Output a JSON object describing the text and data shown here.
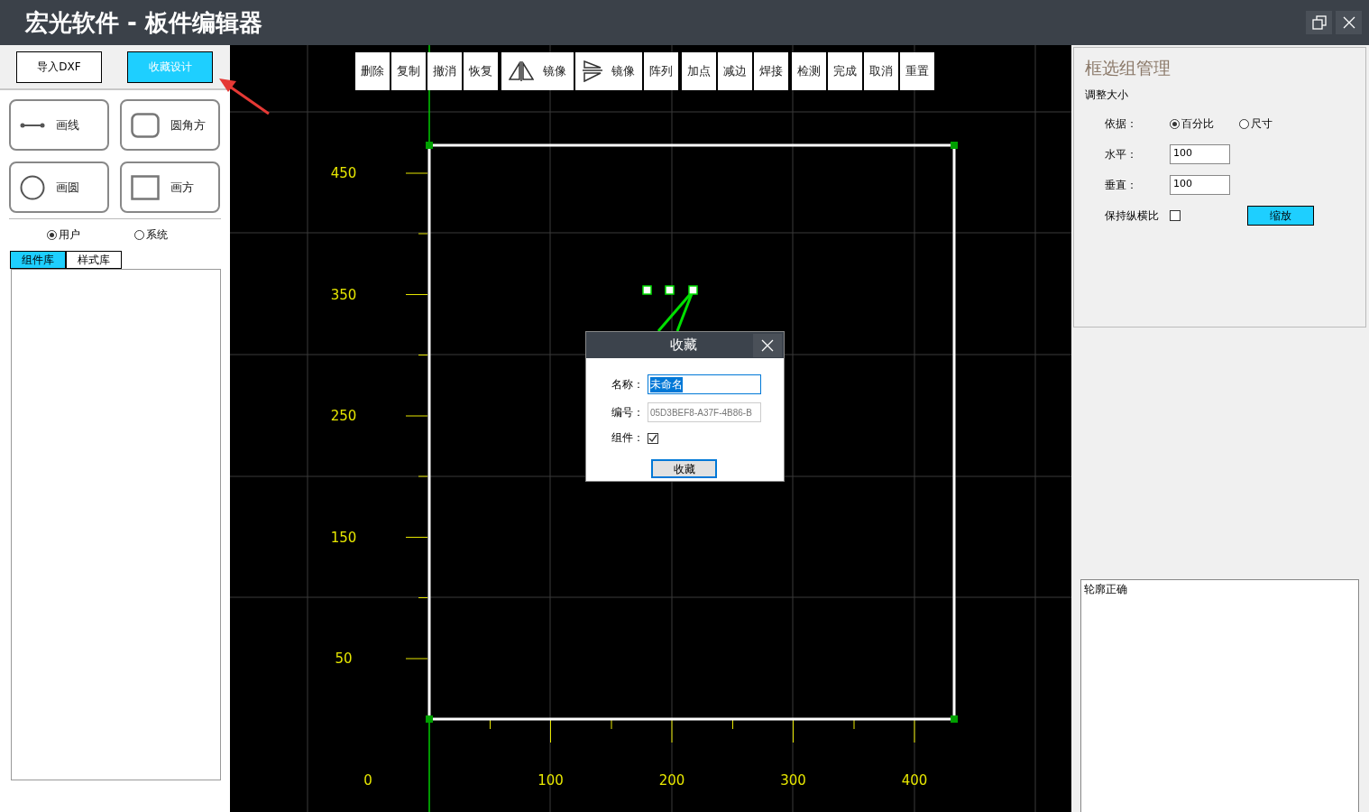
{
  "window": {
    "title": "宏光软件 - 板件编辑器"
  },
  "left_panel": {
    "top_buttons": [
      {
        "label": "导入DXF",
        "kind": "plain"
      },
      {
        "label": "收藏设计",
        "kind": "accent"
      }
    ],
    "tools": [
      {
        "label": "画线",
        "kind": "line"
      },
      {
        "label": "圆角方",
        "kind": "rounded-square"
      },
      {
        "label": "画圆",
        "kind": "circle"
      },
      {
        "label": "画方",
        "kind": "square"
      }
    ],
    "scope": [
      {
        "label": "用户",
        "selected": true
      },
      {
        "label": "系统",
        "selected": false
      }
    ],
    "tabs": [
      {
        "label": "组件库",
        "selected": true
      },
      {
        "label": "样式库",
        "selected": false
      }
    ]
  },
  "toolbar": {
    "groups": [
      {
        "buttons": [
          {
            "label": "删除",
            "kind": "text"
          },
          {
            "label": "复制",
            "kind": "text"
          },
          {
            "label": "撤消",
            "kind": "text"
          },
          {
            "label": "恢复",
            "kind": "text"
          }
        ]
      },
      {
        "buttons": [
          {
            "label": "镜像",
            "kind": "mirror-vertical"
          },
          {
            "label": "镜像",
            "kind": "mirror-horizontal"
          },
          {
            "label": "阵列",
            "kind": "text"
          }
        ]
      },
      {
        "buttons": [
          {
            "label": "加点",
            "kind": "text"
          },
          {
            "label": "减边",
            "kind": "text"
          },
          {
            "label": "焊接",
            "kind": "text"
          }
        ]
      },
      {
        "buttons": [
          {
            "label": "检测",
            "kind": "text"
          },
          {
            "label": "完成",
            "kind": "text"
          },
          {
            "label": "取消",
            "kind": "text"
          },
          {
            "label": "重置",
            "kind": "text"
          }
        ]
      }
    ]
  },
  "canvas": {
    "y_labels": [
      "450",
      "350",
      "250",
      "150",
      "50"
    ],
    "x_labels": [
      "0",
      "100",
      "200",
      "300",
      "400"
    ]
  },
  "dialog": {
    "title": "收藏",
    "name": {
      "label": "名称：",
      "value": "未命名",
      "text_selected": true
    },
    "code": {
      "label": "编号：",
      "value": "05D3BEF8-A37F-4B86-B",
      "disabled": true
    },
    "component": {
      "label": "组件：",
      "checked": true
    },
    "button": "收藏"
  },
  "right_panel": {
    "title": "框选组管理",
    "section": "调整大小",
    "basis_label": "依据：",
    "basis": [
      {
        "label": "百分比",
        "selected": true
      },
      {
        "label": "尺寸",
        "selected": false
      }
    ],
    "horizontal": {
      "label": "水平：",
      "value": "100"
    },
    "vertical": {
      "label": "垂直：",
      "value": "100"
    },
    "keep_ratio": {
      "label": "保持纵横比",
      "checked": false
    },
    "scale_button": "缩放",
    "log": [
      "轮廓正确"
    ]
  }
}
